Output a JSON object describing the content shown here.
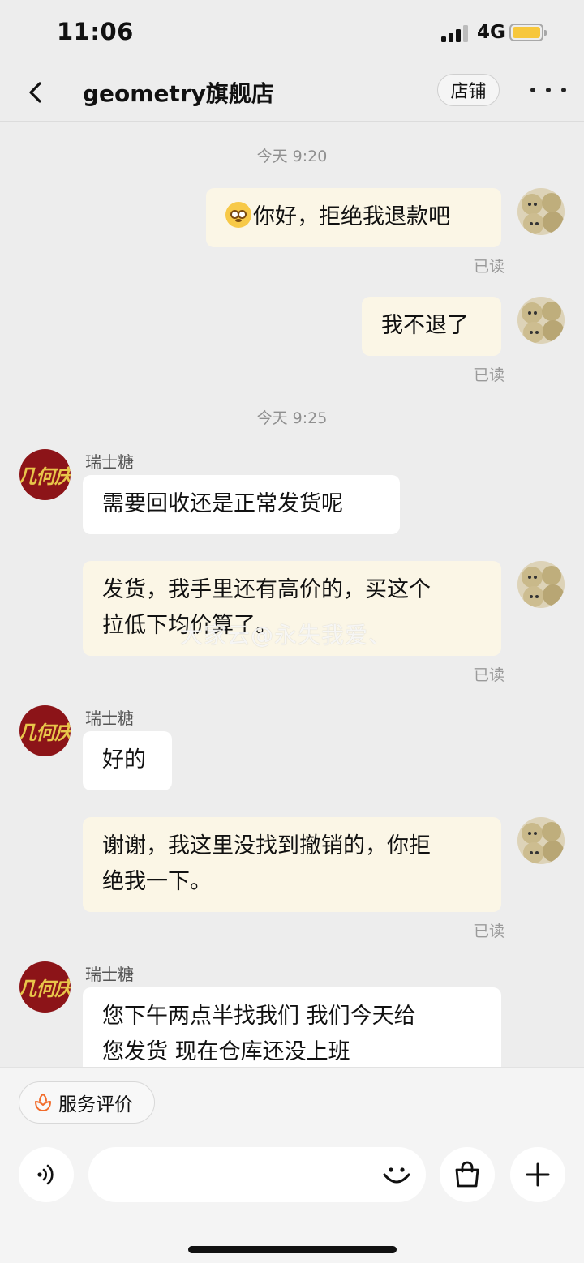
{
  "status_bar": {
    "time": "11:06",
    "network": "4G",
    "battery_color": "#f7c73c"
  },
  "nav": {
    "title": "geometry旗舰店",
    "shop_button": "店铺",
    "back_icon": "chevron-left-icon",
    "more_icon": "more-dots-icon"
  },
  "chat": {
    "timestamps": [
      "今天 9:20",
      "今天 9:25"
    ],
    "read_label": "已读",
    "messages": [
      {
        "from": "me",
        "text": "你好，拒绝我退款吧",
        "emoji": "flushed-face"
      },
      {
        "from": "me",
        "text": "我不退了"
      },
      {
        "from": "shop",
        "sender": "瑞士糖",
        "text": "需要回收还是正常发货呢"
      },
      {
        "from": "me",
        "lines": [
          "发货，我手里还有高价的，买这个",
          "拉低下均价算了。"
        ]
      },
      {
        "from": "shop",
        "sender": "瑞士糖",
        "text": "好的"
      },
      {
        "from": "me",
        "lines": [
          "谢谢，我这里没找到撤销的，你拒",
          "绝我一下。"
        ]
      },
      {
        "from": "shop",
        "sender": "瑞士糖",
        "lines": [
          "您下午两点半找我们 我们今天给",
          "您发货 现在仓库还没上班"
        ]
      }
    ],
    "shop_avatar_text": "几何庆",
    "watermark": "大家云@永失我爱、"
  },
  "bottom": {
    "service_label": "服务评价",
    "input_placeholder": "",
    "icons": [
      "voice-icon",
      "emoji-icon",
      "shopping-bag-icon",
      "plus-icon"
    ],
    "accent_color": "#f26b2a"
  }
}
